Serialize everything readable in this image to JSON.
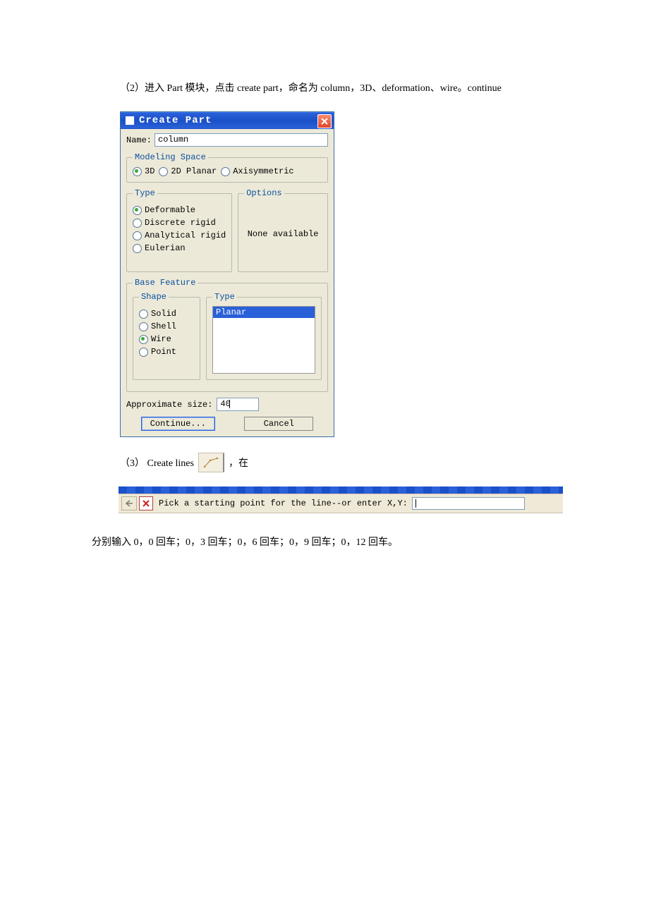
{
  "intro": "（2）进入 Part 模块，点击 create part，命名为 column，3D、deformation、wire。continue",
  "dialog": {
    "title": "Create Part",
    "name_label": "Name:",
    "name_value": "column",
    "modeling_space": {
      "legend": "Modeling Space",
      "options": [
        "3D",
        "2D Planar",
        "Axisymmetric"
      ],
      "selected": "3D"
    },
    "type": {
      "legend": "Type",
      "options": [
        "Deformable",
        "Discrete rigid",
        "Analytical rigid",
        "Eulerian"
      ],
      "selected": "Deformable"
    },
    "options_panel": {
      "legend": "Options",
      "text": "None available"
    },
    "base_feature": {
      "legend": "Base Feature",
      "shape": {
        "legend": "Shape",
        "options": [
          "Solid",
          "Shell",
          "Wire",
          "Point"
        ],
        "selected": "Wire"
      },
      "type_list": {
        "legend": "Type",
        "options": [
          "Planar"
        ],
        "selected": "Planar"
      }
    },
    "approx_label": "Approximate size:",
    "approx_value": "40",
    "continue_btn": "Continue...",
    "cancel_btn": "Cancel"
  },
  "step3_prefix": "（3）  Create lines",
  "step3_suffix": "，在",
  "prompt": {
    "text": "Pick a starting point for the line--or enter X,Y:",
    "value": ""
  },
  "after": "分别输入 0，0 回车；0，3 回车；0，6 回车；0，9 回车；0，12 回车。"
}
